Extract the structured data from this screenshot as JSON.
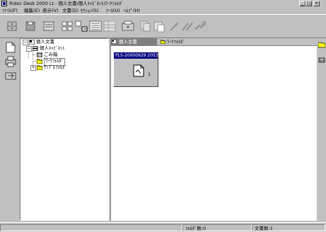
{
  "window": {
    "title": "Ridoc Desk 2000 Lt - 個人文書/個人ｷｬﾋﾞﾈｯﾄ/ﾜｰｸﾌｫﾙﾀﾞ",
    "minimize": "_",
    "maximize": "□",
    "close": "✕"
  },
  "menu": [
    {
      "label": "ﾌｧｲﾙ(F)"
    },
    {
      "label": "編集(E)"
    },
    {
      "label": "表示(V)"
    },
    {
      "label": "文書(D)"
    },
    {
      "label": "ｾｸｼｮﾝ(S)"
    },
    {
      "label": "ﾂｰﾙ(U)"
    },
    {
      "label": "ﾍﾙﾌﾟ(H)"
    }
  ],
  "tree": {
    "root": "個人文書",
    "cabinet": "個人ｷｬﾋﾞﾈｯﾄ",
    "trash": "ごみ箱",
    "work_folder": "ﾜｰｸﾌｫﾙﾀﾞ",
    "sample_folder": "ｻﾝﾌﾟﾙﾌｫﾙﾀﾞ",
    "collapse_symbol": "−",
    "expand_symbol": "+"
  },
  "tabs": [
    {
      "label": "個人文書",
      "active": true
    },
    {
      "label": "ﾜｰｸﾌｫﾙﾀﾞ",
      "active": false
    }
  ],
  "document": {
    "title": "PLS-20000929 2053..",
    "page_count": "1"
  },
  "status": {
    "folder_count": "ﾌｫﾙﾀﾞ数:0",
    "doc_count": "文書数:1"
  },
  "colors": {
    "face": "#c0c0c0",
    "selection": "#000080",
    "folder_yellow": "#ffff00"
  }
}
